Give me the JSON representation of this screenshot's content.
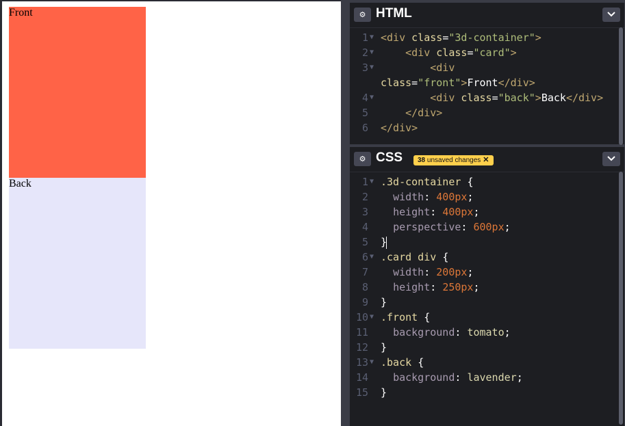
{
  "preview": {
    "front_text": "Front",
    "back_text": "Back",
    "front_color": "#ff6347",
    "back_color": "#e6e6fa"
  },
  "html_panel": {
    "title": "HTML",
    "lines": [
      {
        "num": "1",
        "fold": true,
        "tokens": [
          [
            "tag",
            "<div "
          ],
          [
            "an",
            "class"
          ],
          [
            "w",
            "="
          ],
          [
            "as",
            "\"3d-container\""
          ],
          [
            "tag",
            ">"
          ]
        ]
      },
      {
        "num": "2",
        "fold": true,
        "tokens": [
          [
            "w",
            "    "
          ],
          [
            "tag",
            "<div "
          ],
          [
            "an",
            "class"
          ],
          [
            "w",
            "="
          ],
          [
            "as",
            "\"card\""
          ],
          [
            "tag",
            ">"
          ]
        ]
      },
      {
        "num": "3",
        "fold": true,
        "tokens": [
          [
            "w",
            "        "
          ],
          [
            "tag",
            "<div"
          ]
        ]
      },
      {
        "num": "",
        "fold": false,
        "tokens": [
          [
            "an",
            "class"
          ],
          [
            "w",
            "="
          ],
          [
            "as",
            "\"front\""
          ],
          [
            "tag",
            ">"
          ],
          [
            "w",
            "Front"
          ],
          [
            "tag",
            "</div>"
          ]
        ]
      },
      {
        "num": "4",
        "fold": true,
        "tokens": [
          [
            "w",
            "        "
          ],
          [
            "tag",
            "<div "
          ],
          [
            "an",
            "class"
          ],
          [
            "w",
            "="
          ],
          [
            "as",
            "\"back\""
          ],
          [
            "tag",
            ">"
          ],
          [
            "w",
            "Back"
          ],
          [
            "tag",
            "</div>"
          ]
        ]
      },
      {
        "num": "5",
        "fold": false,
        "tokens": [
          [
            "w",
            "    "
          ],
          [
            "tag",
            "</div>"
          ]
        ]
      },
      {
        "num": "6",
        "fold": false,
        "tokens": [
          [
            "tag",
            "</div>"
          ]
        ]
      }
    ]
  },
  "css_panel": {
    "title": "CSS",
    "badge_count": "38",
    "badge_text": " unsaved changes",
    "badge_close": "✕",
    "lines": [
      {
        "num": "1",
        "fold": true,
        "tokens": [
          [
            "sel",
            ".3d-container "
          ],
          [
            "w",
            "{"
          ]
        ]
      },
      {
        "num": "2",
        "fold": false,
        "tokens": [
          [
            "w",
            "  "
          ],
          [
            "prop",
            "width"
          ],
          [
            "w",
            ": "
          ],
          [
            "num",
            "400px"
          ],
          [
            "w",
            ";"
          ]
        ]
      },
      {
        "num": "3",
        "fold": false,
        "tokens": [
          [
            "w",
            "  "
          ],
          [
            "prop",
            "height"
          ],
          [
            "w",
            ": "
          ],
          [
            "num",
            "400px"
          ],
          [
            "w",
            ";"
          ]
        ]
      },
      {
        "num": "4",
        "fold": false,
        "tokens": [
          [
            "w",
            "  "
          ],
          [
            "prop",
            "perspective"
          ],
          [
            "w",
            ": "
          ],
          [
            "num",
            "600px"
          ],
          [
            "w",
            ";"
          ]
        ]
      },
      {
        "num": "5",
        "fold": false,
        "cursor": true,
        "tokens": [
          [
            "w",
            "}"
          ]
        ]
      },
      {
        "num": "6",
        "fold": true,
        "tokens": [
          [
            "sel",
            ".card div "
          ],
          [
            "w",
            "{"
          ]
        ]
      },
      {
        "num": "7",
        "fold": false,
        "tokens": [
          [
            "w",
            "  "
          ],
          [
            "prop",
            "width"
          ],
          [
            "w",
            ": "
          ],
          [
            "num",
            "200px"
          ],
          [
            "w",
            ";"
          ]
        ]
      },
      {
        "num": "8",
        "fold": false,
        "tokens": [
          [
            "w",
            "  "
          ],
          [
            "prop",
            "height"
          ],
          [
            "w",
            ": "
          ],
          [
            "num",
            "250px"
          ],
          [
            "w",
            ";"
          ]
        ]
      },
      {
        "num": "9",
        "fold": false,
        "tokens": [
          [
            "w",
            "}"
          ]
        ]
      },
      {
        "num": "10",
        "fold": true,
        "tokens": [
          [
            "sel",
            ".front "
          ],
          [
            "w",
            "{"
          ]
        ]
      },
      {
        "num": "11",
        "fold": false,
        "tokens": [
          [
            "w",
            "  "
          ],
          [
            "prop",
            "background"
          ],
          [
            "w",
            ": "
          ],
          [
            "val",
            "tomato"
          ],
          [
            "w",
            ";"
          ]
        ]
      },
      {
        "num": "12",
        "fold": false,
        "tokens": [
          [
            "w",
            "}"
          ]
        ]
      },
      {
        "num": "13",
        "fold": true,
        "tokens": [
          [
            "sel",
            ".back "
          ],
          [
            "w",
            "{"
          ]
        ]
      },
      {
        "num": "14",
        "fold": false,
        "tokens": [
          [
            "w",
            "  "
          ],
          [
            "prop",
            "background"
          ],
          [
            "w",
            ": "
          ],
          [
            "val",
            "lavender"
          ],
          [
            "w",
            ";"
          ]
        ]
      },
      {
        "num": "15",
        "fold": false,
        "tokens": [
          [
            "w",
            "}"
          ]
        ]
      }
    ]
  },
  "icons": {
    "settings": "gear-icon",
    "collapse": "chevron-down-icon",
    "fold": "fold-arrow-icon"
  }
}
